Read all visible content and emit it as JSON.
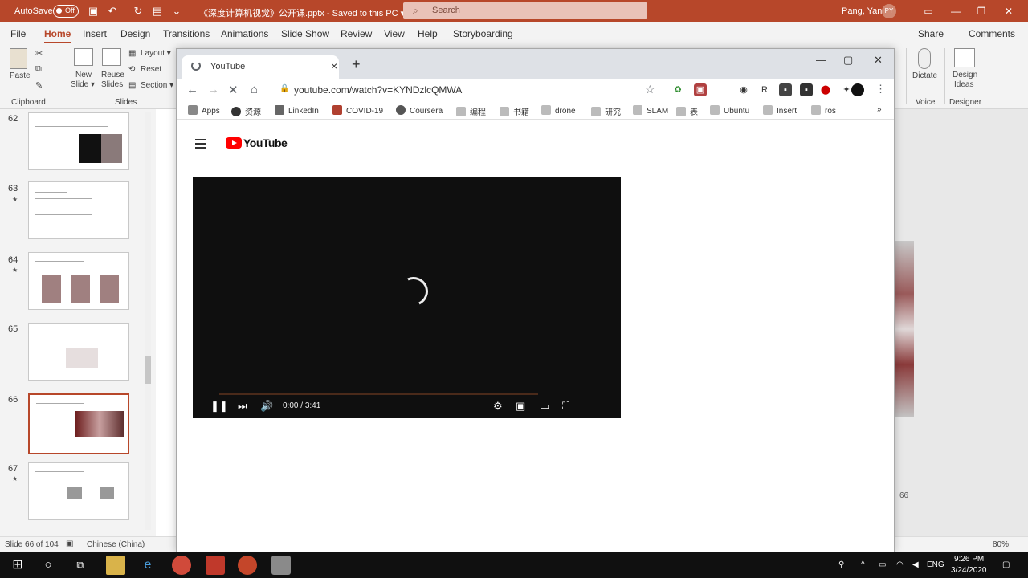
{
  "ppt": {
    "autosave_label": "AutoSave",
    "autosave_state": "Off",
    "doc_title": "《深度计算机视觉》公开课.pptx  -  Saved to this PC  ▾",
    "search_placeholder": "Search",
    "user_name": "Pang, Yan",
    "user_initials": "PY",
    "tabs": [
      "File",
      "Home",
      "Insert",
      "Design",
      "Transitions",
      "Animations",
      "Slide Show",
      "Review",
      "View",
      "Help",
      "Storyboarding"
    ],
    "share_label": "Share",
    "comments_label": "Comments",
    "ribbon": {
      "paste": "Paste",
      "clipboard": "Clipboard",
      "new_slide_1": "New",
      "new_slide_2": "Slide ▾",
      "reuse_slides_1": "Reuse",
      "reuse_slides_2": "Slides",
      "layout": "Layout ▾",
      "reset": "Reset",
      "section": "Section ▾",
      "slides_group": "Slides",
      "dictate": "Dictate",
      "voice_group": "Voice",
      "design_ideas_1": "Design",
      "design_ideas_2": "Ideas",
      "designer_group": "Designer"
    },
    "slides": [
      {
        "num": "62",
        "star": false
      },
      {
        "num": "63",
        "star": true
      },
      {
        "num": "64",
        "star": true
      },
      {
        "num": "65",
        "star": false
      },
      {
        "num": "66",
        "star": false,
        "selected": true
      },
      {
        "num": "67",
        "star": true
      }
    ],
    "status_slide": "Slide 66 of 104",
    "status_lang": "Chinese (China)",
    "zoom": "80%",
    "right_page_num": "66"
  },
  "browser": {
    "tab_title": "YouTube",
    "url": "youtube.com/watch?v=KYNDzlcQMWA",
    "bookmarks": [
      "Apps",
      "资源",
      "LinkedIn",
      "COVID-19",
      "Coursera",
      "编程",
      "书籍",
      "drone",
      "研究",
      "SLAM",
      "表",
      "Ubuntu",
      "Insert",
      "ros"
    ],
    "yt_wordmark": "YouTube",
    "player": {
      "time_current": "0:00",
      "time_total": "3:41",
      "progress": 0.0
    }
  },
  "taskbar": {
    "time": "9:26 PM",
    "date": "3/24/2020",
    "lang": "ENG"
  },
  "colors": {
    "ppt_accent": "#b7472a",
    "youtube_red": "#ff0000",
    "player_bg": "#0f0f0f"
  }
}
